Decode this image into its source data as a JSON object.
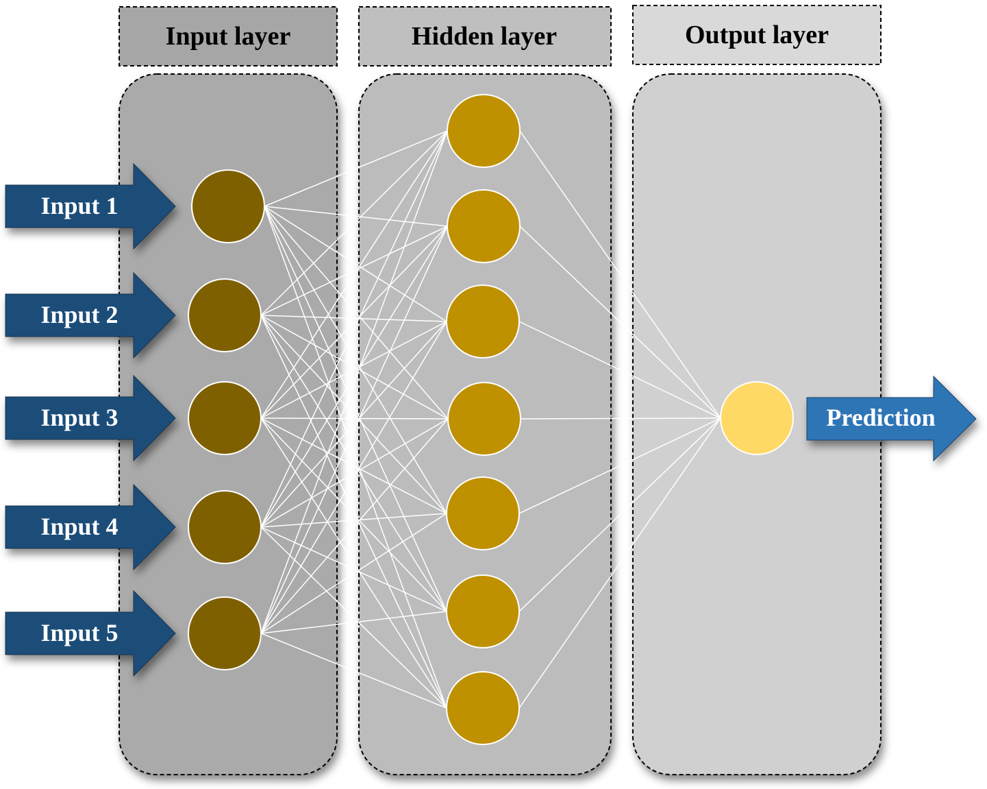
{
  "layers": {
    "input": {
      "title": "Input layer",
      "node_count": 5,
      "panel_color": "#aaaaaa",
      "header_color": "#a6a6a6",
      "node_color": "#7f6000"
    },
    "hidden": {
      "title": "Hidden layer",
      "node_count": 7,
      "panel_color": "#bcbcbc",
      "header_color": "#bfbfbf",
      "node_color": "#bf9000"
    },
    "output": {
      "title": "Output layer",
      "node_count": 1,
      "panel_color": "#d0d0d0",
      "header_color": "#d9d9d9",
      "node_color": "#ffd966"
    }
  },
  "inputs": [
    "Input 1",
    "Input 2",
    "Input 3",
    "Input 4",
    "Input 5"
  ],
  "prediction": "Prediction",
  "colors": {
    "input_arrow": "#1f4e79",
    "prediction_arrow": "#2e75b6",
    "connection": "#ffffff"
  }
}
